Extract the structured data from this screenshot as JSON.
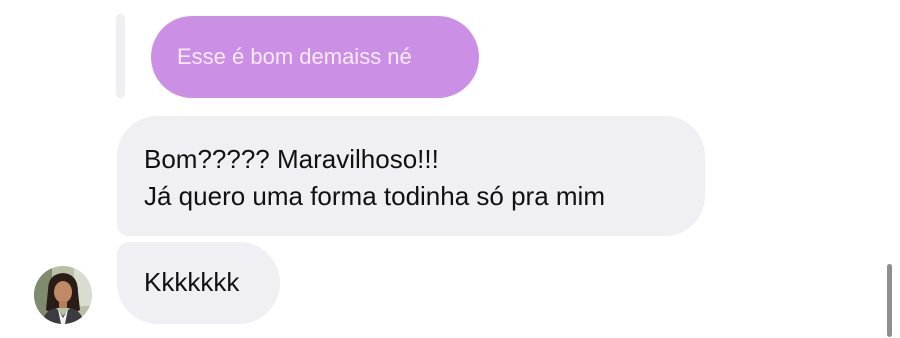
{
  "reply": {
    "quoted_text": "Esse é bom demaiss né"
  },
  "messages": [
    {
      "lines": [
        "Bom????? Maravilhoso!!!",
        "Já quero uma forma todinha só pra mim"
      ]
    },
    {
      "lines": [
        "Kkkkkkk"
      ]
    }
  ],
  "colors": {
    "quoted_bubble": "#cc8fe6",
    "received_bubble": "#efeff4"
  },
  "icons": {
    "avatar": "user-avatar-photo"
  }
}
